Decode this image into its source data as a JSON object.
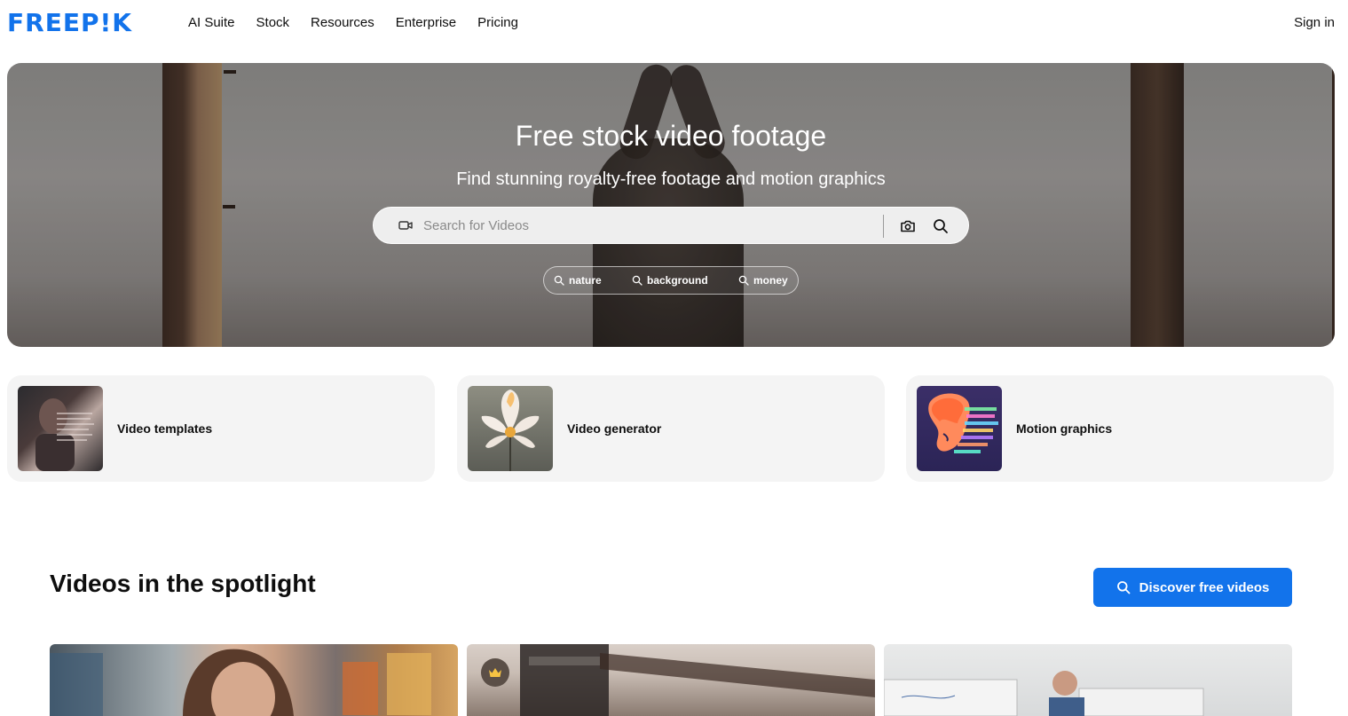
{
  "header": {
    "logo_text": "FREEP!K",
    "nav": [
      "AI Suite",
      "Stock",
      "Resources",
      "Enterprise",
      "Pricing"
    ],
    "sign_in": "Sign in"
  },
  "hero": {
    "title": "Free stock video footage",
    "subtitle": "Find stunning royalty-free footage and motion graphics",
    "search": {
      "placeholder": "Search for Videos",
      "video_icon": "video-camera-icon",
      "camera_icon": "camera-icon",
      "search_icon": "search-icon"
    },
    "suggestions": [
      "nature",
      "background",
      "money"
    ]
  },
  "categories": [
    {
      "label": "Video templates"
    },
    {
      "label": "Video generator"
    },
    {
      "label": "Motion graphics"
    }
  ],
  "spotlight": {
    "title": "Videos in the spotlight",
    "button_label": "Discover free videos",
    "premium_icon": "crown-icon"
  },
  "colors": {
    "brand": "#1273eb",
    "card_bg": "#f4f4f4",
    "text": "#0e0e0e"
  }
}
